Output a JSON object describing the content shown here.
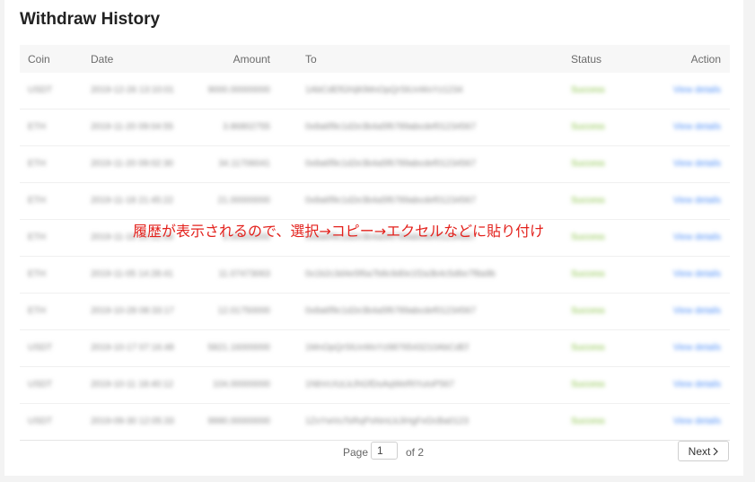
{
  "title": "Withdraw History",
  "table": {
    "columns": [
      "Coin",
      "Date",
      "Amount",
      "To",
      "Status",
      "Action"
    ],
    "rows": [
      {
        "coin": "USDT",
        "date": "2019-12-26 13:10:01",
        "amount": "9000.00000000",
        "to": "1AbCdEfGhIjKlMnOpQrStUvWxYz1234",
        "status": "Success",
        "action": "View details"
      },
      {
        "coin": "ETH",
        "date": "2019-11-20 09:04:55",
        "amount": "3.86802755",
        "to": "0x8a6f9c1d2e3b4a5f6789abcdef01234567",
        "status": "Success",
        "action": "View details"
      },
      {
        "coin": "ETH",
        "date": "2019-11-20 09:02:30",
        "amount": "34.11706041",
        "to": "0x8a6f9c1d2e3b4a5f6789abcdef01234567",
        "status": "Success",
        "action": "View details"
      },
      {
        "coin": "ETH",
        "date": "2019-11-18 21:45:22",
        "amount": "21.00000000",
        "to": "0x8a6f9c1d2e3b4a5f6789abcdef01234567",
        "status": "Success",
        "action": "View details"
      },
      {
        "coin": "ETH",
        "date": "2019-11-18 20:12:09",
        "amount": "5.00000000",
        "to": "0x8a6f9c1d2e3b4a5f6789abcdef01234567",
        "status": "Success",
        "action": "View details"
      },
      {
        "coin": "ETH",
        "date": "2019-11-05 14:28:41",
        "amount": "11.07473063",
        "to": "0x1b2c3d4e5f6a7b8c9d0e1f2a3b4c5d6e7f8a9b",
        "status": "Success",
        "action": "View details"
      },
      {
        "coin": "ETH",
        "date": "2019-10-28 08:33:17",
        "amount": "12.01750000",
        "to": "0x8a6f9c1d2e3b4a5f6789abcdef01234567",
        "status": "Success",
        "action": "View details"
      },
      {
        "coin": "USDT",
        "date": "2019-10-17 07:16:48",
        "amount": "5821.16000000",
        "to": "1MnOpQrStUvWxYz9876543210AbCdEf",
        "status": "Success",
        "action": "View details"
      },
      {
        "coin": "USDT",
        "date": "2019-10-11 18:40:12",
        "amount": "104.00000000",
        "to": "1NbVcXzLkJhGfDsAqWeRtYuIoP567",
        "status": "Success",
        "action": "View details"
      },
      {
        "coin": "USDT",
        "date": "2019-09-30 12:05:33",
        "amount": "9990.00000000",
        "to": "1ZxYwVuTsRqPoNmLkJiHgFeDcBa0123",
        "status": "Success",
        "action": "View details"
      }
    ]
  },
  "annotation": "履歴が表示されるので、選択→コピー→エクセルなどに貼り付け",
  "pagination": {
    "page_label": "Page",
    "current_page": "1",
    "total_label": "of 2",
    "next_label": "Next",
    "next_icon": "chevron-right-icon"
  },
  "colors": {
    "status_success": "#8bc34a",
    "action_link": "#4d8ef7",
    "annotation": "#e3211c"
  }
}
